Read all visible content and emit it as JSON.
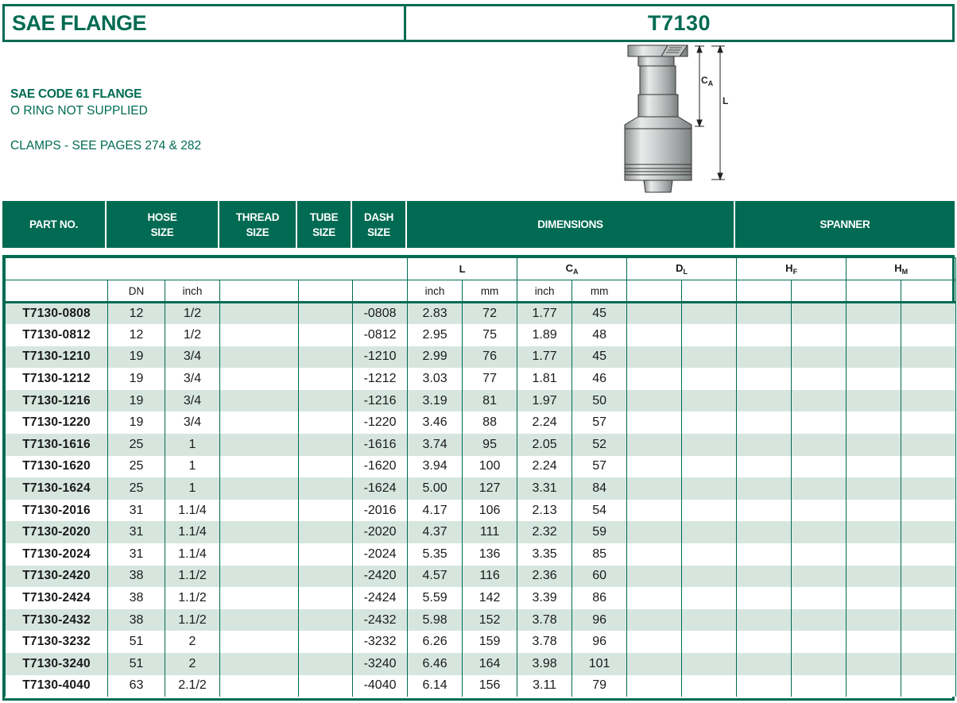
{
  "title": {
    "left": "SAE FLANGE",
    "right": "T7130"
  },
  "description": {
    "line1": "SAE CODE 61 FLANGE",
    "line2": "O RING NOT SUPPLIED",
    "line3": "CLAMPS - SEE PAGES 274 & 282"
  },
  "diagram_labels": {
    "ca_main": "C",
    "ca_sub": "A",
    "l": "L"
  },
  "header": {
    "part_no": "PART NO.",
    "hose_size": "HOSE SIZE",
    "thread_size": "THREAD SIZE",
    "tube_size": "TUBE SIZE",
    "dash_size": "DASH SIZE",
    "dimensions": "DIMENSIONS",
    "spanner": "SPANNER"
  },
  "group_headers": {
    "l": "L",
    "ca": {
      "main": "C",
      "sub": "A"
    },
    "dl": {
      "main": "D",
      "sub": "L"
    },
    "hf": {
      "main": "H",
      "sub": "F"
    },
    "hm": {
      "main": "H",
      "sub": "M"
    }
  },
  "unit_headers": {
    "dn": "DN",
    "inch": "inch",
    "l_inch": "inch",
    "l_mm": "mm",
    "ca_inch": "inch",
    "ca_mm": "mm"
  },
  "rows": [
    {
      "part": "T7130-0808",
      "dn": "12",
      "inch": "1/2",
      "dash": "-0808",
      "l_in": "2.83",
      "l_mm": "72",
      "ca_in": "1.77",
      "ca_mm": "45"
    },
    {
      "part": "T7130-0812",
      "dn": "12",
      "inch": "1/2",
      "dash": "-0812",
      "l_in": "2.95",
      "l_mm": "75",
      "ca_in": "1.89",
      "ca_mm": "48"
    },
    {
      "part": "T7130-1210",
      "dn": "19",
      "inch": "3/4",
      "dash": "-1210",
      "l_in": "2.99",
      "l_mm": "76",
      "ca_in": "1.77",
      "ca_mm": "45"
    },
    {
      "part": "T7130-1212",
      "dn": "19",
      "inch": "3/4",
      "dash": "-1212",
      "l_in": "3.03",
      "l_mm": "77",
      "ca_in": "1.81",
      "ca_mm": "46"
    },
    {
      "part": "T7130-1216",
      "dn": "19",
      "inch": "3/4",
      "dash": "-1216",
      "l_in": "3.19",
      "l_mm": "81",
      "ca_in": "1.97",
      "ca_mm": "50"
    },
    {
      "part": "T7130-1220",
      "dn": "19",
      "inch": "3/4",
      "dash": "-1220",
      "l_in": "3.46",
      "l_mm": "88",
      "ca_in": "2.24",
      "ca_mm": "57"
    },
    {
      "part": "T7130-1616",
      "dn": "25",
      "inch": "1",
      "dash": "-1616",
      "l_in": "3.74",
      "l_mm": "95",
      "ca_in": "2.05",
      "ca_mm": "52"
    },
    {
      "part": "T7130-1620",
      "dn": "25",
      "inch": "1",
      "dash": "-1620",
      "l_in": "3.94",
      "l_mm": "100",
      "ca_in": "2.24",
      "ca_mm": "57"
    },
    {
      "part": "T7130-1624",
      "dn": "25",
      "inch": "1",
      "dash": "-1624",
      "l_in": "5.00",
      "l_mm": "127",
      "ca_in": "3.31",
      "ca_mm": "84"
    },
    {
      "part": "T7130-2016",
      "dn": "31",
      "inch": "1.1/4",
      "dash": "-2016",
      "l_in": "4.17",
      "l_mm": "106",
      "ca_in": "2.13",
      "ca_mm": "54"
    },
    {
      "part": "T7130-2020",
      "dn": "31",
      "inch": "1.1/4",
      "dash": "-2020",
      "l_in": "4.37",
      "l_mm": "111",
      "ca_in": "2.32",
      "ca_mm": "59"
    },
    {
      "part": "T7130-2024",
      "dn": "31",
      "inch": "1.1/4",
      "dash": "-2024",
      "l_in": "5.35",
      "l_mm": "136",
      "ca_in": "3.35",
      "ca_mm": "85"
    },
    {
      "part": "T7130-2420",
      "dn": "38",
      "inch": "1.1/2",
      "dash": "-2420",
      "l_in": "4.57",
      "l_mm": "116",
      "ca_in": "2.36",
      "ca_mm": "60"
    },
    {
      "part": "T7130-2424",
      "dn": "38",
      "inch": "1.1/2",
      "dash": "-2424",
      "l_in": "5.59",
      "l_mm": "142",
      "ca_in": "3.39",
      "ca_mm": "86"
    },
    {
      "part": "T7130-2432",
      "dn": "38",
      "inch": "1.1/2",
      "dash": "-2432",
      "l_in": "5.98",
      "l_mm": "152",
      "ca_in": "3.78",
      "ca_mm": "96"
    },
    {
      "part": "T7130-3232",
      "dn": "51",
      "inch": "2",
      "dash": "-3232",
      "l_in": "6.26",
      "l_mm": "159",
      "ca_in": "3.78",
      "ca_mm": "96"
    },
    {
      "part": "T7130-3240",
      "dn": "51",
      "inch": "2",
      "dash": "-3240",
      "l_in": "6.46",
      "l_mm": "164",
      "ca_in": "3.98",
      "ca_mm": "101"
    },
    {
      "part": "T7130-4040",
      "dn": "63",
      "inch": "2.1/2",
      "dash": "-4040",
      "l_in": "6.14",
      "l_mm": "156",
      "ca_in": "3.11",
      "ca_mm": "79"
    }
  ],
  "colors": {
    "brand_green": "#006b52",
    "row_shade": "#d6e6df"
  }
}
